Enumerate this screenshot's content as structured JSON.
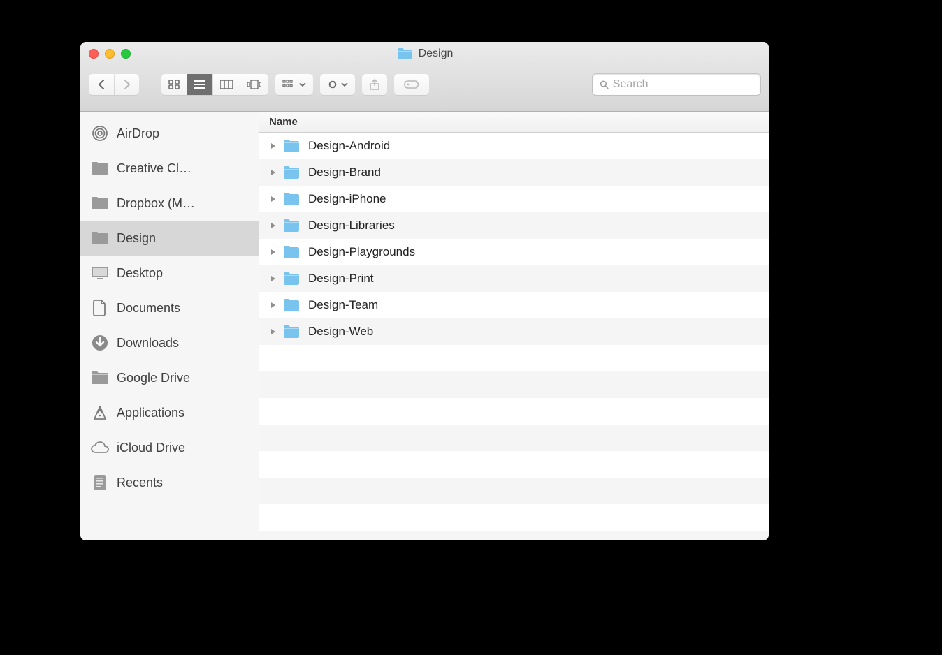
{
  "window": {
    "title": "Design"
  },
  "search": {
    "placeholder": "Search"
  },
  "columns": {
    "name": "Name"
  },
  "sidebar": {
    "items": [
      {
        "label": "AirDrop",
        "icon": "airdrop",
        "selected": false
      },
      {
        "label": "Creative Cl…",
        "icon": "folder-gray",
        "selected": false
      },
      {
        "label": "Dropbox (M…",
        "icon": "folder-gray",
        "selected": false
      },
      {
        "label": "Design",
        "icon": "folder-gray",
        "selected": true
      },
      {
        "label": "Desktop",
        "icon": "desktop",
        "selected": false
      },
      {
        "label": "Documents",
        "icon": "documents",
        "selected": false
      },
      {
        "label": "Downloads",
        "icon": "downloads",
        "selected": false
      },
      {
        "label": "Google Drive",
        "icon": "folder-gray",
        "selected": false
      },
      {
        "label": "Applications",
        "icon": "applications",
        "selected": false
      },
      {
        "label": "iCloud Drive",
        "icon": "cloud",
        "selected": false
      },
      {
        "label": "Recents",
        "icon": "recents",
        "selected": false
      }
    ]
  },
  "files": [
    {
      "name": "Design-Android"
    },
    {
      "name": "Design-Brand"
    },
    {
      "name": "Design-iPhone"
    },
    {
      "name": "Design-Libraries"
    },
    {
      "name": "Design-Playgrounds"
    },
    {
      "name": "Design-Print"
    },
    {
      "name": "Design-Team"
    },
    {
      "name": "Design-Web"
    }
  ],
  "empty_rows": 8
}
